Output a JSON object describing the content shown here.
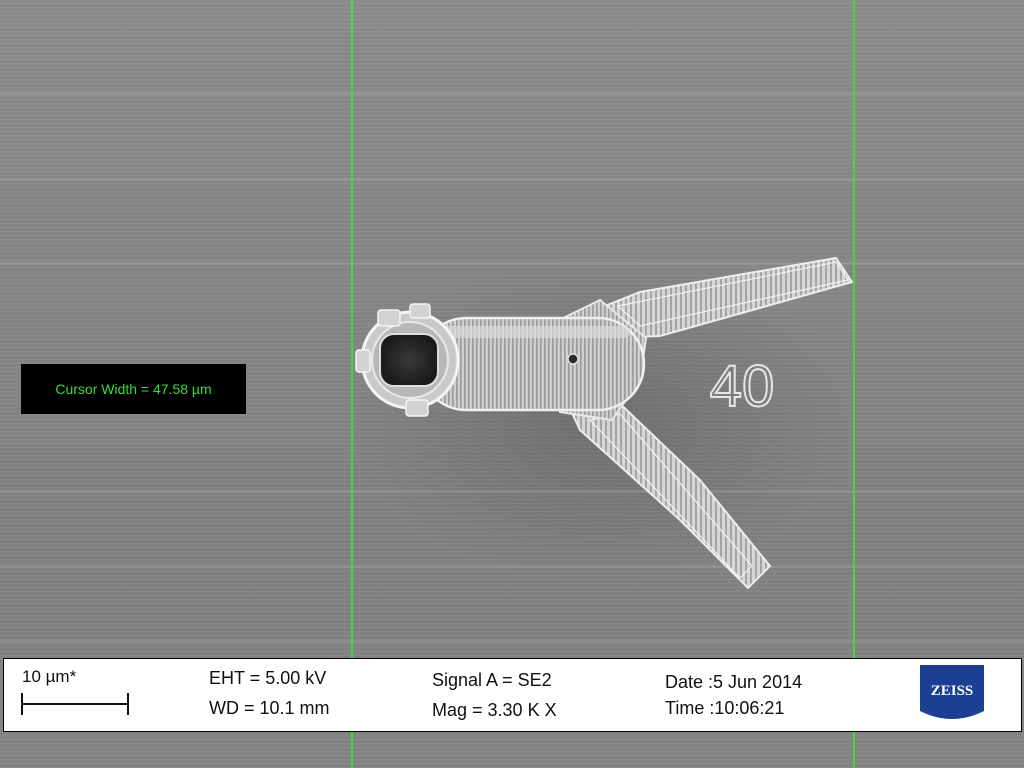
{
  "measurement": {
    "cursor_text": "Cursor Width = 47.58 µm",
    "cursor_color": "#3ddb3d"
  },
  "sample": {
    "engraved_label": "40"
  },
  "info_bar": {
    "scale_label": "10 µm*",
    "eht": "EHT =  5.00 kV",
    "wd": "WD = 10.1 mm",
    "signal": "Signal A = SE2",
    "mag": "Mag =    3.30 K X",
    "date": "Date :5 Jun 2014",
    "time": "Time :10:06:21",
    "logo_text": "ZEISS",
    "logo_color": "#1c3f94"
  }
}
